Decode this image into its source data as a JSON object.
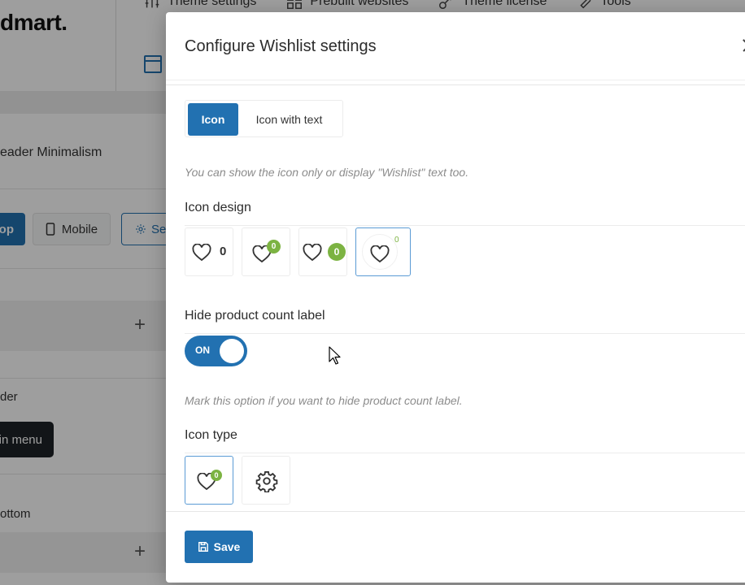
{
  "background": {
    "logo": "dmart.",
    "topnav": [
      {
        "label": "Theme settings",
        "icon": "sliders-icon"
      },
      {
        "label": "Prebuilt websites",
        "icon": "grid-icon"
      },
      {
        "label": "Theme license",
        "icon": "key-icon"
      },
      {
        "label": "Tools",
        "icon": "wrench-icon"
      }
    ],
    "header_name": "eader Minimalism",
    "desktop_label": "op",
    "mobile_label": "Mobile",
    "settings_label": "Se",
    "row1_label": "der",
    "main_menu_label": "in menu",
    "row2_label": "ottom"
  },
  "modal": {
    "title": "Configure Wishlist settings",
    "display_mode": {
      "options": [
        "Icon",
        "Icon with text"
      ],
      "selected": "Icon",
      "hint": "You can show the icon only or display \"Wishlist\" text too."
    },
    "icon_design": {
      "title": "Icon design",
      "options": [
        {
          "name": "heart-count-inline",
          "count": "0"
        },
        {
          "name": "heart-badge-top",
          "count": "0"
        },
        {
          "name": "heart-badge-side",
          "count": "0"
        },
        {
          "name": "heart-ring-superscript",
          "count": "0"
        }
      ],
      "selected_index": 3
    },
    "hide_count": {
      "title": "Hide product count label",
      "toggle_label": "ON",
      "state": true,
      "hint": "Mark this option if you want to hide product count label."
    },
    "icon_type": {
      "title": "Icon type",
      "options": [
        {
          "name": "heart-icon",
          "count": "0"
        },
        {
          "name": "gear-icon"
        }
      ],
      "selected_index": 0
    },
    "save_label": "Save"
  },
  "colors": {
    "accent": "#2271b1",
    "badge": "#7cb342"
  }
}
